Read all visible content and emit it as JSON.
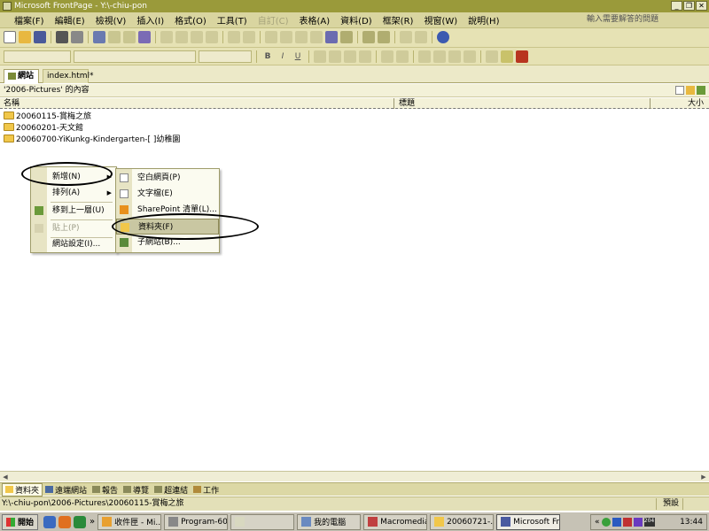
{
  "window": {
    "title": "Microsoft FrontPage - Y:\\-chiu-pon",
    "controls": [
      "_",
      "❐",
      "✕"
    ]
  },
  "menubar": {
    "items": [
      {
        "label": "檔案(F)",
        "enabled": true
      },
      {
        "label": "編輯(E)",
        "enabled": true
      },
      {
        "label": "檢視(V)",
        "enabled": true
      },
      {
        "label": "插入(I)",
        "enabled": true
      },
      {
        "label": "格式(O)",
        "enabled": true
      },
      {
        "label": "工具(T)",
        "enabled": true
      },
      {
        "label": "自訂(C)",
        "enabled": false
      },
      {
        "label": "表格(A)",
        "enabled": true
      },
      {
        "label": "資料(D)",
        "enabled": true
      },
      {
        "label": "框架(R)",
        "enabled": true
      },
      {
        "label": "視窗(W)",
        "enabled": true
      },
      {
        "label": "說明(H)",
        "enabled": true
      }
    ],
    "help_placeholder": "輸入需要解答的問題"
  },
  "format_toolbar": {
    "bold": "B",
    "italic": "I",
    "underline": "U"
  },
  "tabs": {
    "active": "網站",
    "inactive": "index.html*"
  },
  "content": {
    "title": "'2006-Pictures' 的內容",
    "col_name": "名稱",
    "col_title": "標題",
    "col_size": "大小"
  },
  "folders": [
    "20060115-賞梅之旅",
    "20060201-天文館",
    "20060700-YiKunkg-Kindergarten-[ ]幼稚園"
  ],
  "context_menu": {
    "new": "新增(N)",
    "arrange": "排列(A)",
    "up": "移到上一層(U)",
    "paste": "貼上(P)",
    "site_settings": "網站設定(I)..."
  },
  "submenu": {
    "blank_page": "空白網頁(P)",
    "text_file": "文字檔(E)",
    "sharepoint_list": "SharePoint 清單(L)...",
    "folder": "資料夾(F)",
    "subsite": "子網站(B)..."
  },
  "views": [
    "資料夾",
    "遠端網站",
    "報告",
    "導覽",
    "超連結",
    "工作"
  ],
  "status": {
    "path": "Y:\\-chiu-pon\\2006-Pictures\\20060115-賞梅之旅",
    "mode": "預設"
  },
  "taskbar": {
    "start": "開始",
    "more": "»",
    "tasks": [
      "收件匣 - Mi...",
      "Program-60...",
      "",
      "我的電腦",
      "Macromedia...",
      "20060721-...",
      "Microsoft Fr..."
    ],
    "tray_label": "204",
    "clock": "13:44"
  },
  "colors": {
    "titlebar": "#9a9a3a",
    "menubar": "#d9d5a0",
    "toolbar": "#e6e2b4",
    "highlight": "#c9c7a2"
  }
}
